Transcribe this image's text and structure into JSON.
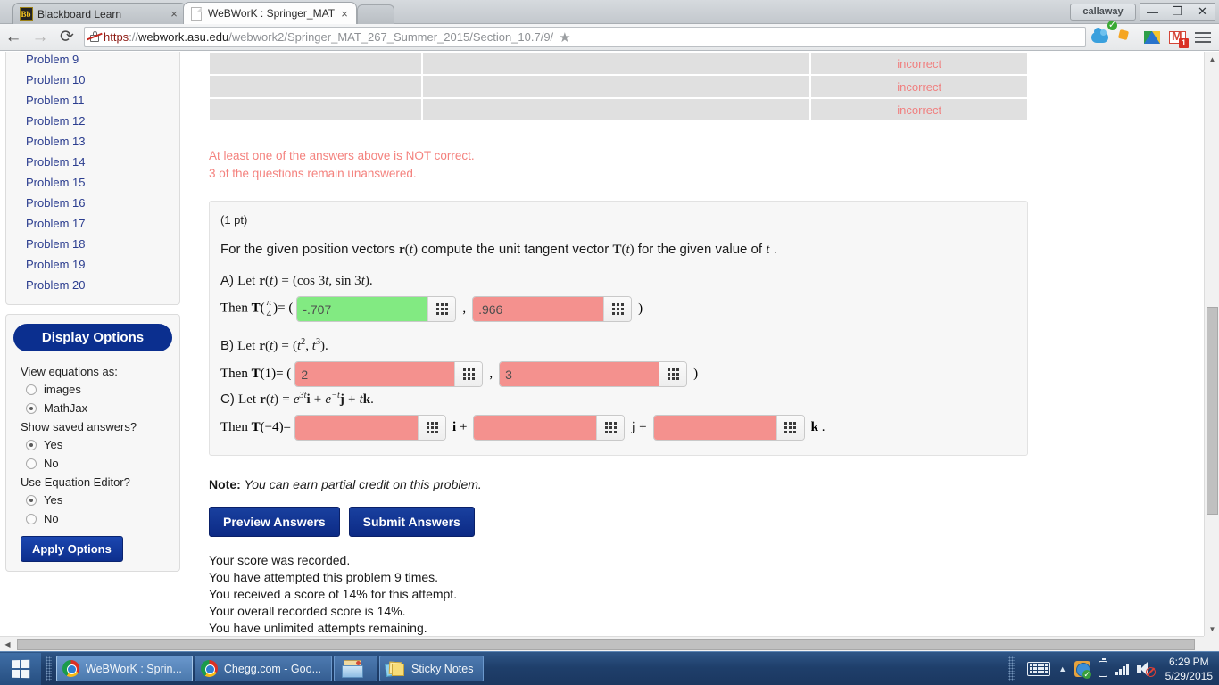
{
  "browser": {
    "tabs": [
      {
        "title": "Blackboard Learn",
        "icon": "blackboard-icon",
        "active": false
      },
      {
        "title": "WeBWorK : Springer_MAT",
        "icon": "document-icon",
        "active": true
      }
    ],
    "close_glyph": "×",
    "nav": {
      "back_glyph": "←",
      "forward_glyph": "→",
      "reload_glyph": "⟳"
    },
    "url": {
      "scheme": "https",
      "separator": "://",
      "host": "webwork.asu.edu",
      "path": "/webwork2/Springer_MAT_267_Summer_2015/Section_10.7/9/",
      "security": "broken-https"
    },
    "star_glyph": "★",
    "extensions": [
      "onedrive-icon",
      "adblock-check-icon",
      "google-drive-icon",
      "gmail-icon"
    ],
    "gmail_badge": "1",
    "window": {
      "user": "callaway",
      "minimize_glyph": "—",
      "restore_glyph": "❐",
      "close_glyph": "✕"
    }
  },
  "sidebar": {
    "problems": [
      {
        "label": "Problem 9"
      },
      {
        "label": "Problem 10"
      },
      {
        "label": "Problem 11"
      },
      {
        "label": "Problem 12"
      },
      {
        "label": "Problem 13"
      },
      {
        "label": "Problem 14"
      },
      {
        "label": "Problem 15"
      },
      {
        "label": "Problem 16"
      },
      {
        "label": "Problem 17"
      },
      {
        "label": "Problem 18"
      },
      {
        "label": "Problem 19"
      },
      {
        "label": "Problem 20"
      }
    ],
    "display_options": {
      "header": "Display Options",
      "view_equations_label": "View equations as:",
      "view_equations_options": [
        {
          "label": "images",
          "selected": false
        },
        {
          "label": "MathJax",
          "selected": true
        }
      ],
      "show_saved_label": "Show saved answers?",
      "show_saved_options": [
        {
          "label": "Yes",
          "selected": true
        },
        {
          "label": "No",
          "selected": false
        }
      ],
      "equation_editor_label": "Use Equation Editor?",
      "equation_editor_options": [
        {
          "label": "Yes",
          "selected": true
        },
        {
          "label": "No",
          "selected": false
        }
      ],
      "apply_label": "Apply Options"
    }
  },
  "main": {
    "results_table": {
      "rows": [
        {
          "entered": "",
          "preview": "",
          "status": "incorrect"
        },
        {
          "entered": "",
          "preview": "",
          "status": "incorrect"
        },
        {
          "entered": "",
          "preview": "",
          "status": "incorrect"
        }
      ]
    },
    "alerts": [
      "At least one of the answers above is NOT correct.",
      "3 of the questions remain unanswered."
    ],
    "problem": {
      "points": "(1 pt)",
      "prompt_prefix": "For the given position vectors",
      "prompt_mid": "compute the unit tangent vector",
      "prompt_suffix": "for the given value of",
      "prompt_var": "t",
      "parts": [
        {
          "letter": "A)",
          "let_text": "Let",
          "definition": "(cos 3t, sin 3t)",
          "then_text": "Then",
          "eval_point": "π/4",
          "fields": [
            {
              "value": "-.707",
              "state": "correct"
            },
            {
              "value": ".966",
              "state": "incorrect"
            }
          ],
          "open_paren": "(",
          "close_paren": ")",
          "comma": ","
        },
        {
          "letter": "B)",
          "let_text": "Let",
          "definition": "(t², t³)",
          "then_text": "Then",
          "eval_point": "1",
          "fields": [
            {
              "value": "2",
              "state": "incorrect"
            },
            {
              "value": "3",
              "state": "incorrect"
            }
          ],
          "open_paren": "(",
          "close_paren": ")",
          "comma": ","
        },
        {
          "letter": "C)",
          "let_text": "Let",
          "definition": "e^{3t} i + e^{-t} j + t k",
          "then_text": "Then",
          "eval_point": "−4",
          "fields": [
            {
              "value": "",
              "state": "incorrect",
              "unit": "i"
            },
            {
              "value": "",
              "state": "incorrect",
              "unit": "j"
            },
            {
              "value": "",
              "state": "incorrect",
              "unit": "k"
            }
          ]
        }
      ],
      "keypad_icon": "equation-editor-keypad-icon"
    },
    "note_label": "Note:",
    "note_text": "You can earn partial credit on this problem.",
    "buttons": [
      {
        "label": "Preview Answers",
        "name": "preview-answers-button"
      },
      {
        "label": "Submit Answers",
        "name": "submit-answers-button"
      }
    ],
    "score_lines": [
      "Your score was recorded.",
      "You have attempted this problem 9 times.",
      "You received a score of 14% for this attempt.",
      "Your overall recorded score is 14%.",
      "You have unlimited attempts remaining."
    ]
  },
  "scrollbars": {
    "up_glyph": "▲",
    "down_glyph": "▼",
    "left_glyph": "◀",
    "right_glyph": "▶"
  },
  "taskbar": {
    "start_name": "start-button",
    "items": [
      {
        "label": "WeBWorK : Sprin...",
        "icon": "chrome-icon",
        "active": true
      },
      {
        "label": "Chegg.com - Goo...",
        "icon": "chrome-icon",
        "active": false
      },
      {
        "label": "",
        "icon": "file-explorer-icon",
        "active": false
      },
      {
        "label": "Sticky Notes",
        "icon": "sticky-notes-icon",
        "active": false
      }
    ],
    "tray": {
      "keyboard_icon": "keyboard-icon",
      "show_hidden_glyph": "▲",
      "network_icon": "network-icon",
      "battery_icon": "battery-icon",
      "signal_icon": "signal-icon",
      "volume_icon": "volume-muted-icon",
      "time": "6:29 PM",
      "date": "5/29/2015"
    }
  },
  "colors": {
    "accent_blue": "#0b2f8f",
    "correct_green": "#82ea82",
    "incorrect_red": "#f4918e",
    "alert_text": "#f4827e",
    "link_blue": "#2b3d8f"
  }
}
